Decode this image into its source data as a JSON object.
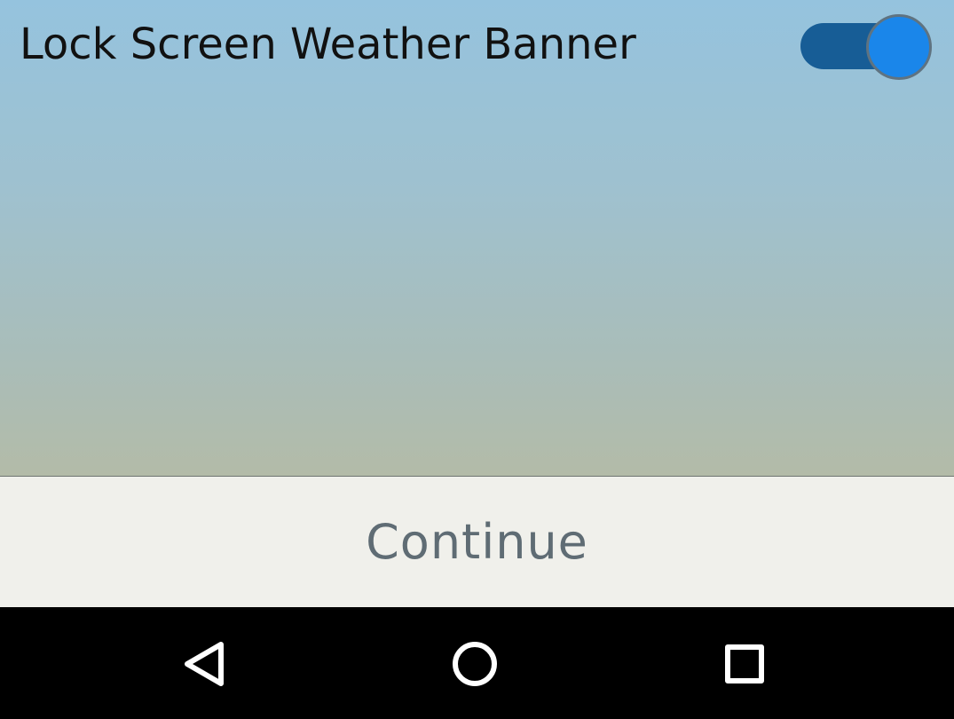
{
  "setting": {
    "label": "Lock Screen Weather Banner",
    "toggle_state": "on",
    "toggle_track_color": "#175d96",
    "toggle_thumb_color": "#1a86ea"
  },
  "footer": {
    "continue_label": "Continue"
  },
  "navigation": {
    "back_icon": "back-triangle-icon",
    "home_icon": "home-circle-icon",
    "recents_icon": "recents-square-icon"
  }
}
